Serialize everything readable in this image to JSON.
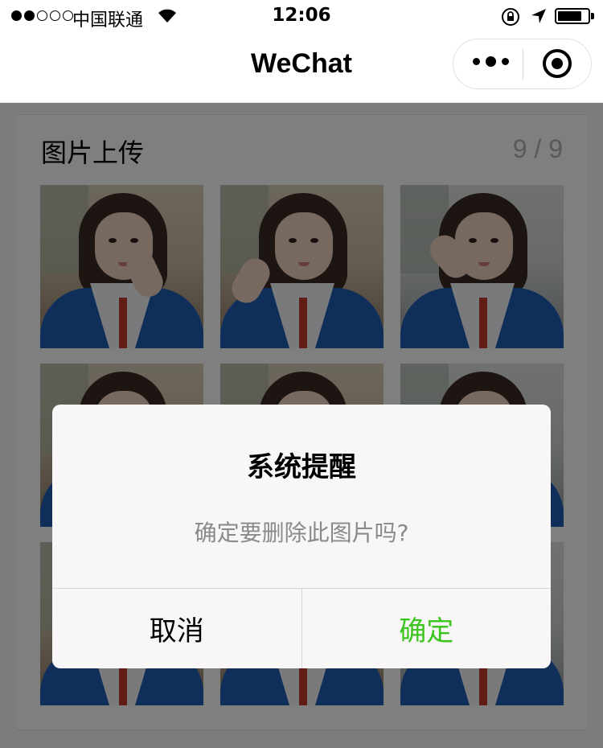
{
  "status_bar": {
    "carrier": "中国联通",
    "time": "12:06",
    "battery_level": 0.8,
    "signal_strength": 2
  },
  "nav": {
    "title": "WeChat"
  },
  "upload": {
    "title": "图片上传",
    "count": "9 / 9",
    "photo_count": 9
  },
  "dialog": {
    "title": "系统提醒",
    "content": "确定要删除此图片吗?",
    "cancel_label": "取消",
    "confirm_label": "确定",
    "confirm_color": "#3cc51f"
  },
  "colors": {
    "overlay": "rgba(0,0,0,0.5)",
    "wechat_green": "#3cc51f"
  }
}
